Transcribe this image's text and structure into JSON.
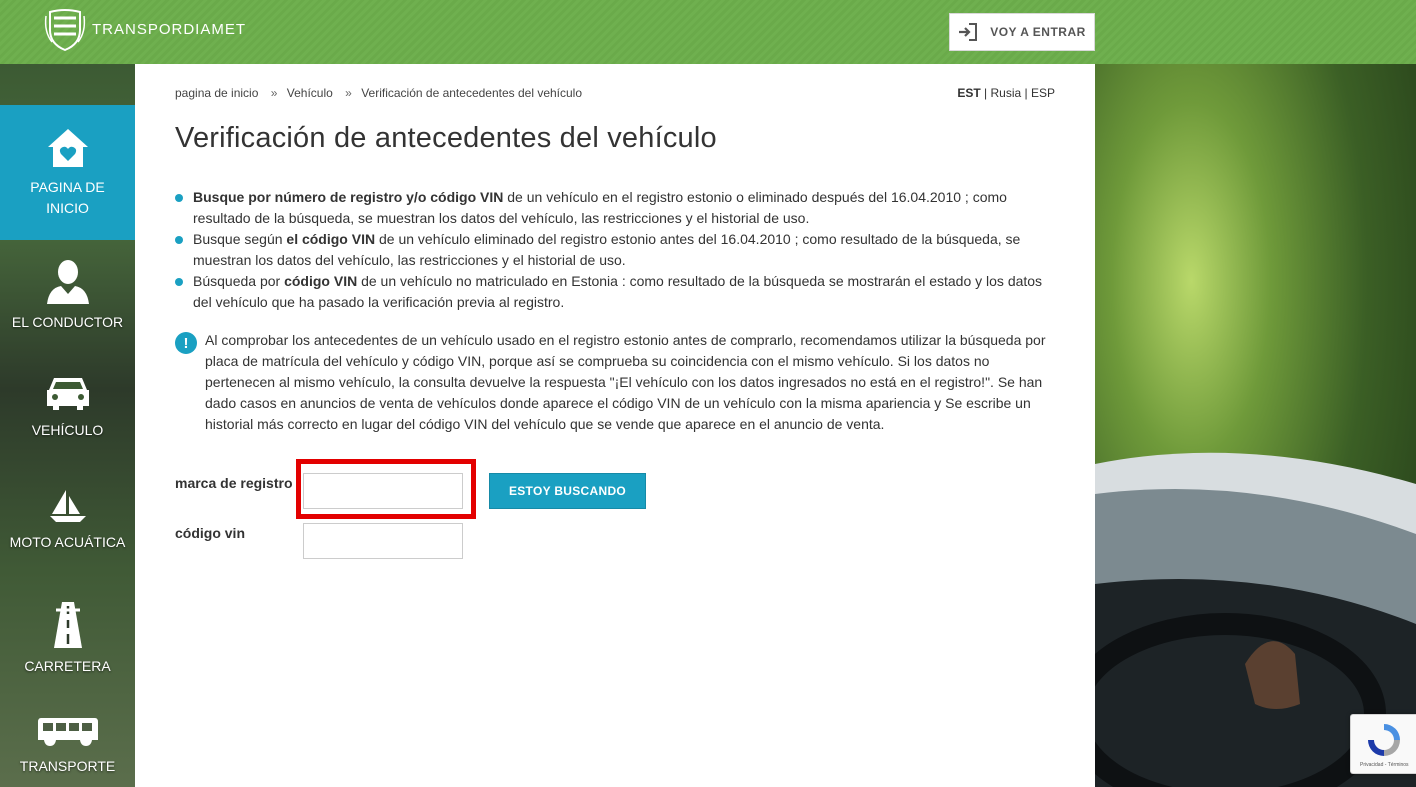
{
  "header": {
    "logo_text": "TRANSPORDIAMET",
    "login_label": "VOY A ENTRAR"
  },
  "sidebar": {
    "items": [
      {
        "label": "PAGINA DE INICIO",
        "icon": "home-heart-icon",
        "active": true
      },
      {
        "label": "EL CONDUCTOR",
        "icon": "driver-person-icon",
        "active": false
      },
      {
        "label": "VEHÍCULO",
        "icon": "car-icon",
        "active": false
      },
      {
        "label": "MOTO ACUÁTICA",
        "icon": "sailboat-icon",
        "active": false
      },
      {
        "label": "CARRETERA",
        "icon": "road-icon",
        "active": false
      },
      {
        "label": "TRANSPORTE",
        "icon": "bus-icon",
        "active": false
      }
    ]
  },
  "breadcrumb": {
    "items": [
      "pagina de inicio",
      "Vehículo",
      "Verificación de antecedentes del vehículo"
    ],
    "separator": "»"
  },
  "languages": {
    "est": "EST",
    "rus": "Rusia",
    "esp": "ESP",
    "divider": "|"
  },
  "page": {
    "title": "Verificación de antecedentes del vehículo",
    "bullets": [
      {
        "bold": "Busque por número de registro y/o código VIN",
        "before": "",
        "after": " de un vehículo en el registro estonio o eliminado después del 16.04.2010 ; como resultado de la búsqueda, se muestran los datos del vehículo, las restricciones y el historial de uso."
      },
      {
        "before": "Busque según ",
        "bold": "el código VIN",
        "after": " de un vehículo eliminado del registro estonio antes del 16.04.2010 ; como resultado de la búsqueda, se muestran los datos del vehículo, las restricciones y el historial de uso."
      },
      {
        "before": "Búsqueda por ",
        "bold": "código VIN",
        "after": " de un vehículo no matriculado en Estonia : como resultado de la búsqueda se mostrarán el estado y los datos del vehículo que ha pasado la verificación previa al registro."
      }
    ],
    "info_icon": "!",
    "info_text": "Al comprobar los antecedentes de un vehículo usado en el registro estonio antes de comprarlo, recomendamos utilizar la búsqueda por placa de matrícula del vehículo y código VIN, porque así se comprueba su coincidencia con el mismo vehículo. Si los datos no pertenecen al mismo vehículo, la consulta devuelve la respuesta \"¡El vehículo con los datos ingresados no está en el registro!\". Se han dado casos en anuncios de venta de vehículos donde aparece el código VIN de un vehículo con la misma apariencia y Se escribe un historial más correcto en lugar del código VIN del vehículo que se vende que aparece en el anuncio de venta."
  },
  "form": {
    "reg_label": "marca de registro",
    "reg_value": "",
    "vin_label": "código vin",
    "vin_value": "",
    "search_label": "ESTOY BUSCANDO"
  },
  "recaptcha": {
    "terms": "Privacidad - Términos"
  },
  "colors": {
    "accent": "#1aa0c2",
    "header_green": "#6fb04f",
    "highlight": "#e30000"
  }
}
